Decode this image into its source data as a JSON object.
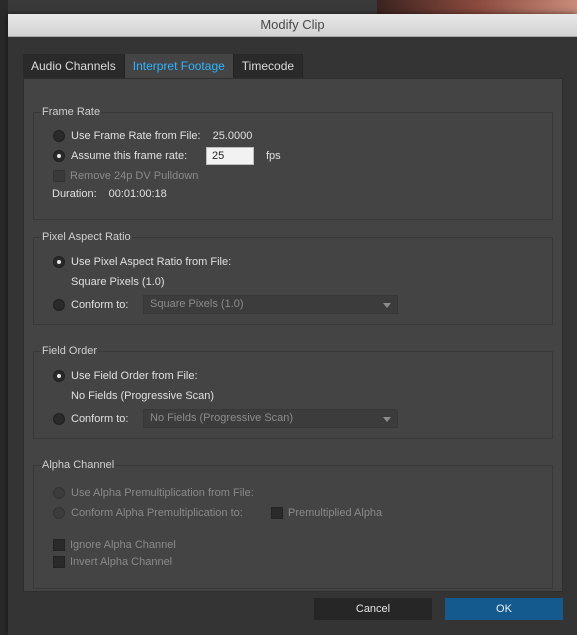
{
  "window": {
    "title": "Modify Clip"
  },
  "tabs": [
    {
      "label": "Audio Channels",
      "active": false
    },
    {
      "label": "Interpret Footage",
      "active": true
    },
    {
      "label": "Timecode",
      "active": false
    }
  ],
  "frame_rate": {
    "title": "Frame Rate",
    "use_file_label": "Use Frame Rate from File:",
    "use_file_value": "25.0000",
    "assume_label": "Assume this frame rate:",
    "assume_value": "25",
    "assume_unit": "fps",
    "remove_pulldown_label": "Remove 24p DV Pulldown",
    "duration_label": "Duration:",
    "duration_value": "00:01:00:18",
    "selected": "assume"
  },
  "pixel_aspect": {
    "title": "Pixel Aspect Ratio",
    "use_file_label": "Use Pixel Aspect Ratio from File:",
    "use_file_value": "Square Pixels (1.0)",
    "conform_label": "Conform to:",
    "conform_value": "Square Pixels (1.0)",
    "selected": "use_file"
  },
  "field_order": {
    "title": "Field Order",
    "use_file_label": "Use Field Order from File:",
    "use_file_value": "No Fields (Progressive Scan)",
    "conform_label": "Conform to:",
    "conform_value": "No Fields (Progressive Scan)",
    "selected": "use_file"
  },
  "alpha": {
    "title": "Alpha Channel",
    "use_file_label": "Use Alpha Premultiplication from File:",
    "conform_label": "Conform Alpha Premultiplication to:",
    "premultiplied_label": "Premultiplied Alpha",
    "ignore_label": "Ignore Alpha Channel",
    "invert_label": "Invert Alpha Channel"
  },
  "buttons": {
    "cancel": "Cancel",
    "ok": "OK"
  },
  "colors": {
    "accent": "#2fb4ff",
    "ok_button": "#155a8f",
    "panel": "#444444"
  }
}
